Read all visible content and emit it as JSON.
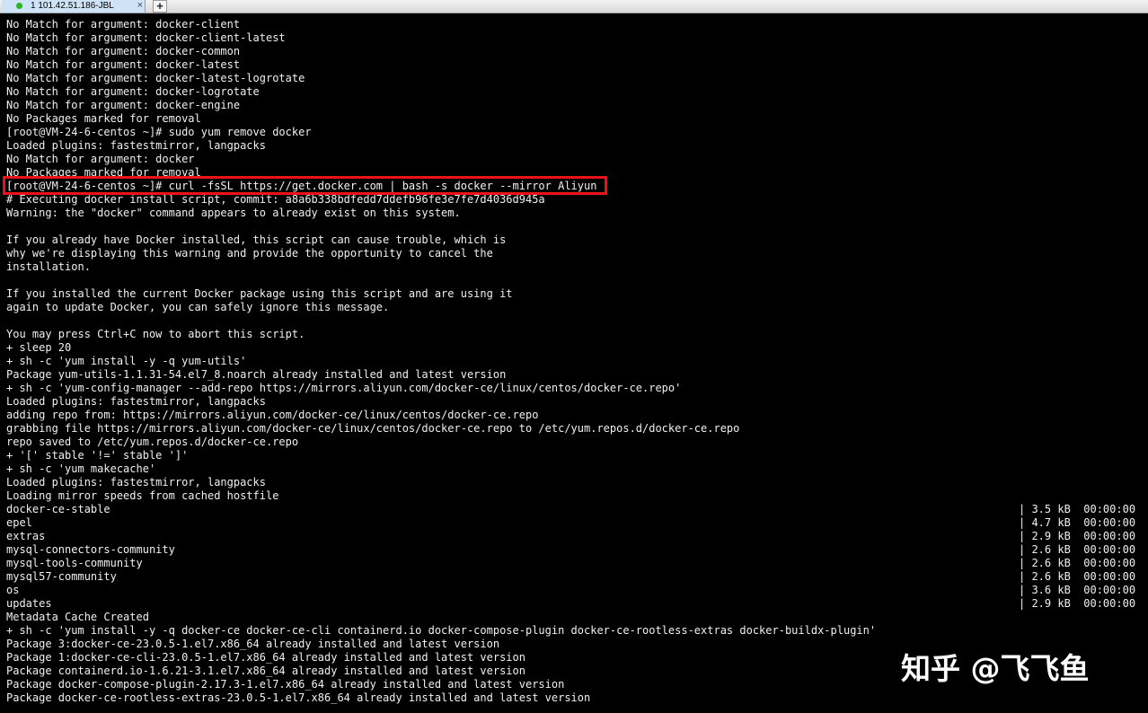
{
  "tab": {
    "title": "1 101.42.51.186-JBL",
    "close_glyph": "×",
    "add_glyph": "+"
  },
  "terminal": {
    "lines": [
      "No Match for argument: docker-client",
      "No Match for argument: docker-client-latest",
      "No Match for argument: docker-common",
      "No Match for argument: docker-latest",
      "No Match for argument: docker-latest-logrotate",
      "No Match for argument: docker-logrotate",
      "No Match for argument: docker-engine",
      "No Packages marked for removal",
      "[root@VM-24-6-centos ~]# sudo yum remove docker",
      "Loaded plugins: fastestmirror, langpacks",
      "No Match for argument: docker",
      "No Packages marked for removal",
      "[root@VM-24-6-centos ~]# curl -fsSL https://get.docker.com | bash -s docker --mirror Aliyun",
      "# Executing docker install script, commit: a8a6b338bdfedd7ddefb96fe3e7fe7d4036d945a",
      "Warning: the \"docker\" command appears to already exist on this system.",
      "",
      "If you already have Docker installed, this script can cause trouble, which is",
      "why we're displaying this warning and provide the opportunity to cancel the",
      "installation.",
      "",
      "If you installed the current Docker package using this script and are using it",
      "again to update Docker, you can safely ignore this message.",
      "",
      "You may press Ctrl+C now to abort this script.",
      "+ sleep 20",
      "+ sh -c 'yum install -y -q yum-utils'",
      "Package yum-utils-1.1.31-54.el7_8.noarch already installed and latest version",
      "+ sh -c 'yum-config-manager --add-repo https://mirrors.aliyun.com/docker-ce/linux/centos/docker-ce.repo'",
      "Loaded plugins: fastestmirror, langpacks",
      "adding repo from: https://mirrors.aliyun.com/docker-ce/linux/centos/docker-ce.repo",
      "grabbing file https://mirrors.aliyun.com/docker-ce/linux/centos/docker-ce.repo to /etc/yum.repos.d/docker-ce.repo",
      "repo saved to /etc/yum.repos.d/docker-ce.repo",
      "+ '[' stable '!=' stable ']'",
      "+ sh -c 'yum makecache'",
      "Loaded plugins: fastestmirror, langpacks",
      "Loading mirror speeds from cached hostfile",
      "docker-ce-stable",
      "epel",
      "extras",
      "mysql-connectors-community",
      "mysql-tools-community",
      "mysql57-community",
      "os",
      "updates",
      "Metadata Cache Created",
      "+ sh -c 'yum install -y -q docker-ce docker-ce-cli containerd.io docker-compose-plugin docker-ce-rootless-extras docker-buildx-plugin'",
      "Package 3:docker-ce-23.0.5-1.el7.x86_64 already installed and latest version",
      "Package 1:docker-ce-cli-23.0.5-1.el7.x86_64 already installed and latest version",
      "Package containerd.io-1.6.21-3.1.el7.x86_64 already installed and latest version",
      "Package docker-compose-plugin-2.17.3-1.el7.x86_64 already installed and latest version",
      "Package docker-ce-rootless-extras-23.0.5-1.el7.x86_64 already installed and latest version"
    ],
    "repo_stats": [
      "| 3.5 kB  00:00:00",
      "| 4.7 kB  00:00:00",
      "| 2.9 kB  00:00:00",
      "| 2.6 kB  00:00:00",
      "| 2.6 kB  00:00:00",
      "| 2.6 kB  00:00:00",
      "| 3.6 kB  00:00:00",
      "| 2.9 kB  00:00:00"
    ]
  },
  "watermark": "知乎 @飞飞鱼",
  "colors": {
    "background": "#000000",
    "text": "#f0f0f0",
    "highlight_box": "#e8141a",
    "tab_active": "#cfe3f6",
    "status_dot": "#28b428"
  }
}
